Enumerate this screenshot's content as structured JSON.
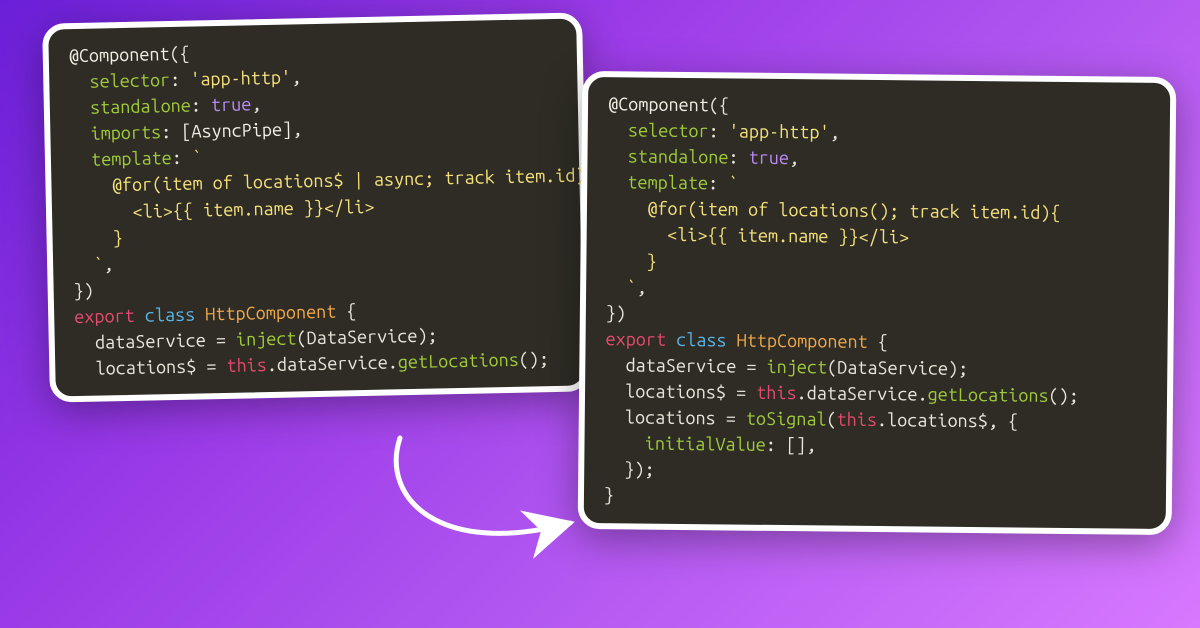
{
  "left": {
    "decorator": "@Component",
    "selector_key": "selector",
    "selector_val": "'app-http'",
    "standalone_key": "standalone",
    "standalone_val": "true",
    "imports_key": "imports",
    "imports_val": "[AsyncPipe]",
    "template_key": "template",
    "forLine": "@for(item of locations$ | async; track item.id)",
    "liLine": "<li>{{ item.name }}</li>",
    "closeFor": "}",
    "backtick": "`",
    "closeObj": "})",
    "export": "export",
    "classKw": "class",
    "className": "HttpComponent",
    "brace": "{",
    "dsLine_a": "dataService = ",
    "dsLine_b": "inject",
    "dsLine_c": "(DataService);",
    "locLine_a": "locations$ = ",
    "locLine_this": "this",
    "locLine_b": ".dataService.",
    "locLine_c": "getLocations",
    "locLine_d": "();"
  },
  "right": {
    "decorator": "@Component",
    "selector_key": "selector",
    "selector_val": "'app-http'",
    "standalone_key": "standalone",
    "standalone_val": "true",
    "template_key": "template",
    "forLine": "@for(item of locations(); track item.id){",
    "liLine": "<li>{{ item.name }}</li>",
    "closeFor": "}",
    "backtick": "`",
    "closeObj": "})",
    "export": "export",
    "classKw": "class",
    "className": "HttpComponent",
    "brace": "{",
    "dsLine_a": "dataService = ",
    "dsLine_b": "inject",
    "dsLine_c": "(DataService);",
    "locLine_a": "locations$ = ",
    "locLine_this": "this",
    "locLine_b": ".dataService.",
    "locLine_c": "getLocations",
    "locLine_d": "();",
    "sigLine_a": "locations = ",
    "sigLine_b": "toSignal",
    "sigLine_c": "(",
    "sigLine_this": "this",
    "sigLine_d": ".locations$, {",
    "ivKey": "initialValue",
    "ivVal": ": [],",
    "sigClose": "});",
    "endBrace": "}"
  }
}
